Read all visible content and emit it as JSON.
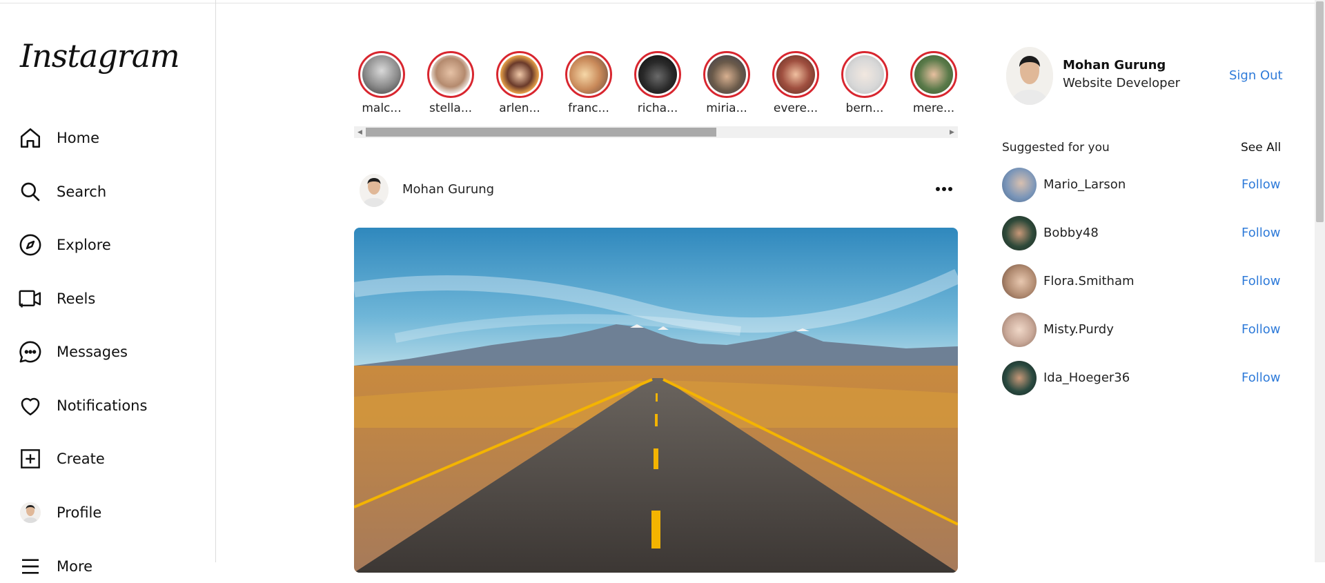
{
  "app": {
    "logo": "Instagram"
  },
  "sidebar": {
    "items": [
      {
        "label": "Home",
        "icon": "home-icon"
      },
      {
        "label": "Search",
        "icon": "search-icon"
      },
      {
        "label": "Explore",
        "icon": "compass-icon"
      },
      {
        "label": "Reels",
        "icon": "reels-icon"
      },
      {
        "label": "Messages",
        "icon": "message-bubble-icon"
      },
      {
        "label": "Notifications",
        "icon": "heart-icon"
      },
      {
        "label": "Create",
        "icon": "plus-square-icon"
      },
      {
        "label": "Profile",
        "icon": "profile-avatar"
      },
      {
        "label": "More",
        "icon": "menu-icon"
      }
    ]
  },
  "stories": [
    {
      "name": "malc...",
      "color": "#8a8a8a"
    },
    {
      "name": "stella...",
      "color": "#c9a58a"
    },
    {
      "name": "arlen...",
      "color": "#e8a24a"
    },
    {
      "name": "franc...",
      "color": "#c98a5a"
    },
    {
      "name": "richa...",
      "color": "#3a3a3a"
    },
    {
      "name": "miria...",
      "color": "#6a5a4a"
    },
    {
      "name": "evere...",
      "color": "#a05040"
    },
    {
      "name": "bern...",
      "color": "#d8d8d8"
    },
    {
      "name": "mere...",
      "color": "#5a7a4a"
    }
  ],
  "post": {
    "username": "Mohan Gurung",
    "more_icon": "more-horizontal-icon"
  },
  "current_user": {
    "name": "Mohan Gurung",
    "role": "Website Developer",
    "sign_out_label": "Sign Out"
  },
  "suggestions": {
    "title": "Suggested for you",
    "see_all_label": "See All",
    "follow_label": "Follow",
    "users": [
      {
        "username": "Mario_Larson",
        "color": "#7a95b8"
      },
      {
        "username": "Bobby48",
        "color": "#2f4a3a"
      },
      {
        "username": "Flora.Smitham",
        "color": "#b08a70"
      },
      {
        "username": "Misty.Purdy",
        "color": "#c8a898"
      },
      {
        "username": "Ida_Hoeger36",
        "color": "#2a4a40"
      }
    ]
  },
  "colors": {
    "accent": "#2f7bd9",
    "story_ring": "#d8262f",
    "border": "#dbdbdb"
  }
}
